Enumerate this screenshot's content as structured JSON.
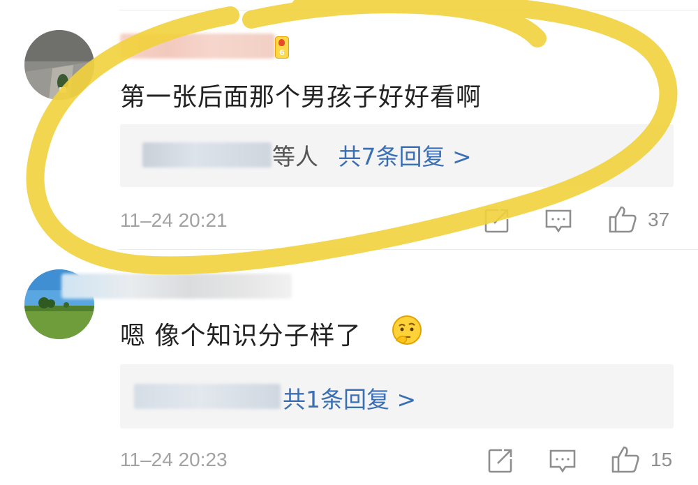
{
  "comments": [
    {
      "text": "第一张后面那个男孩子好好看啊",
      "badge_level": "6",
      "reply_suffix": "等人",
      "reply_count": "共7条回复 >",
      "time": "11–24 20:21",
      "likes": "37"
    },
    {
      "text": "嗯 像个知识分子样了",
      "emoji": "thinking-emoji",
      "reply_count": "共1条回复 >",
      "time": "11–24 20:23",
      "likes": "15"
    }
  ],
  "icons": {
    "share": "share-icon",
    "comment": "comment-icon",
    "like": "thumbs-up-icon"
  },
  "colors": {
    "link": "#3a6fb4",
    "meta": "#a2a2a2",
    "reply_bg": "#f4f4f4",
    "highlight": "#f2d23c"
  }
}
